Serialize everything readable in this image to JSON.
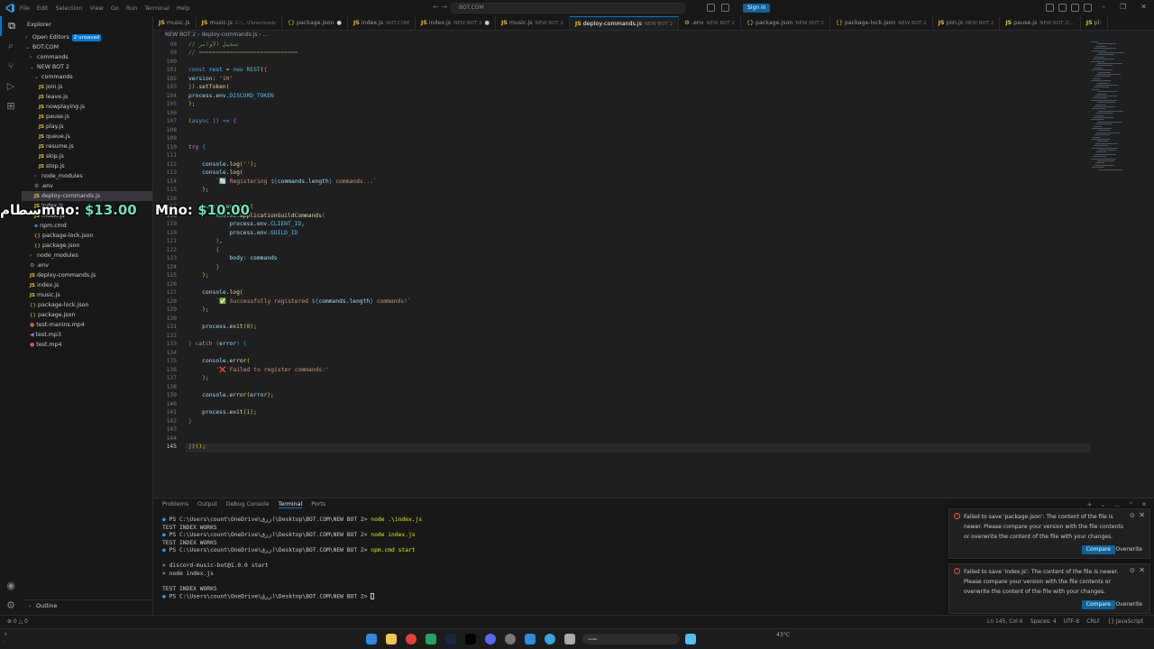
{
  "titlebar": {
    "menu": [
      "File",
      "Edit",
      "Selection",
      "View",
      "Go",
      "Run",
      "Terminal",
      "Help"
    ],
    "search": "BOT.COM",
    "signin": "Sign in"
  },
  "sidebar": {
    "title": "Explorer",
    "open_editors": "Open Editors",
    "open_editors_badge": "2 unsaved",
    "root": "BOT.COM",
    "outline": "Outline",
    "rows": [
      {
        "indent": 1,
        "chev": "›",
        "icon": "",
        "label": "commands"
      },
      {
        "indent": 1,
        "chev": "⌄",
        "icon": "",
        "label": "NEW BOT 2"
      },
      {
        "indent": 2,
        "chev": "⌄",
        "icon": "",
        "label": "commands"
      },
      {
        "indent": 3,
        "chev": "",
        "icon": "js",
        "label": "join.js"
      },
      {
        "indent": 3,
        "chev": "",
        "icon": "js",
        "label": "leave.js"
      },
      {
        "indent": 3,
        "chev": "",
        "icon": "js",
        "label": "nowplaying.js"
      },
      {
        "indent": 3,
        "chev": "",
        "icon": "js",
        "label": "pause.js"
      },
      {
        "indent": 3,
        "chev": "",
        "icon": "js",
        "label": "play.js"
      },
      {
        "indent": 3,
        "chev": "",
        "icon": "js",
        "label": "queue.js"
      },
      {
        "indent": 3,
        "chev": "",
        "icon": "js",
        "label": "resume.js"
      },
      {
        "indent": 3,
        "chev": "",
        "icon": "js",
        "label": "skip.js"
      },
      {
        "indent": 3,
        "chev": "",
        "icon": "js",
        "label": "stop.js"
      },
      {
        "indent": 2,
        "chev": "›",
        "icon": "",
        "label": "node_modules"
      },
      {
        "indent": 2,
        "chev": "",
        "icon": "gear",
        "label": ".env"
      },
      {
        "indent": 2,
        "chev": "",
        "icon": "js",
        "label": "deploy-commands.js",
        "selected": true
      },
      {
        "indent": 2,
        "chev": "",
        "icon": "js",
        "label": "index.js"
      },
      {
        "indent": 2,
        "chev": "",
        "icon": "js",
        "label": "music.js"
      },
      {
        "indent": 2,
        "chev": "",
        "icon": "cmd",
        "label": "npm.cmd"
      },
      {
        "indent": 2,
        "chev": "",
        "icon": "json",
        "label": "package-lock.json"
      },
      {
        "indent": 2,
        "chev": "",
        "icon": "json",
        "label": "package.json"
      },
      {
        "indent": 1,
        "chev": "›",
        "icon": "",
        "label": "node_modules"
      },
      {
        "indent": 1,
        "chev": "",
        "icon": "gear",
        "label": ".env"
      },
      {
        "indent": 1,
        "chev": "",
        "icon": "js",
        "label": "deploy-commands.js"
      },
      {
        "indent": 1,
        "chev": "",
        "icon": "js",
        "label": "index.js"
      },
      {
        "indent": 1,
        "chev": "",
        "icon": "js",
        "label": "music.js"
      },
      {
        "indent": 1,
        "chev": "",
        "icon": "json",
        "label": "package-lock.json"
      },
      {
        "indent": 1,
        "chev": "",
        "icon": "json",
        "label": "package.json"
      },
      {
        "indent": 1,
        "chev": "",
        "icon": "media",
        "label": "test-manins.mp4"
      },
      {
        "indent": 1,
        "chev": "",
        "icon": "audio",
        "label": "test.mp3"
      },
      {
        "indent": 1,
        "chev": "",
        "icon": "media",
        "label": "test.mp4"
      }
    ]
  },
  "overlay": {
    "text1_prefix": "سطام",
    "text1_label": "mno:",
    "text1_value": "$13.00",
    "text2_label": "Mno:",
    "text2_value": "$10.00"
  },
  "tabs": [
    {
      "icon": "js",
      "label": "music.js",
      "path": "",
      "dot": false,
      "active": false
    },
    {
      "icon": "js",
      "label": "music.js",
      "path": "C:\\...\\Downloads",
      "dot": false,
      "active": false
    },
    {
      "icon": "json",
      "label": "package.json",
      "path": "",
      "dot": true,
      "active": false
    },
    {
      "icon": "js",
      "label": "index.js",
      "path": "NOT.COM",
      "dot": false,
      "active": false
    },
    {
      "icon": "js",
      "label": "index.js",
      "path": "NEW BOT 2",
      "dot": true,
      "active": false
    },
    {
      "icon": "js",
      "label": "music.js",
      "path": "NEW BOT 2",
      "dot": false,
      "active": false
    },
    {
      "icon": "js",
      "label": "deploy-commands.js",
      "path": "NEW BOT 2",
      "dot": false,
      "active": true
    },
    {
      "icon": "gear",
      "label": ".env",
      "path": "NEW BOT 2",
      "dot": false,
      "active": false
    },
    {
      "icon": "json",
      "label": "package.json",
      "path": "NEW BOT 2",
      "dot": false,
      "active": false
    },
    {
      "icon": "json",
      "label": "package-lock.json",
      "path": "NEW BOT 2",
      "dot": false,
      "active": false
    },
    {
      "icon": "js",
      "label": "join.js",
      "path": "NEW BOT 2",
      "dot": false,
      "active": false
    },
    {
      "icon": "js",
      "label": "pause.js",
      "path": "NEW BOT 2\\...",
      "dot": false,
      "active": false
    },
    {
      "icon": "js",
      "label": "pl:",
      "path": "",
      "dot": false,
      "active": false
    }
  ],
  "breadcrumb": [
    "NEW BOT 2",
    "deploy-commands.js",
    "..."
  ],
  "code_lines": [
    {
      "n": 98,
      "html": "<span class=\"cmt\">// تسجيل الأوامر</span>"
    },
    {
      "n": 99,
      "html": "<span class=\"cmt\">// =============================</span>"
    },
    {
      "n": 100,
      "html": ""
    },
    {
      "n": 101,
      "html": "<span class=\"kw\">const</span> <span class=\"cst\">rest</span> = <span class=\"kw\">new</span> <span class=\"cls\">REST</span><span class=\"br1\">(</span><span class=\"br2\">{</span>"
    },
    {
      "n": 102,
      "html": "<span class=\"var\">version</span>: <span class=\"str\">'10'</span>"
    },
    {
      "n": 103,
      "html": "<span class=\"br2\">}</span><span class=\"br1\">)</span>.<span class=\"fn\">setToken</span><span class=\"br1\">(</span>"
    },
    {
      "n": 104,
      "html": "<span class=\"var\">process</span>.<span class=\"var\">env</span>.<span class=\"cst\">DISCORD_TOKEN</span>"
    },
    {
      "n": 105,
      "html": "<span class=\"br1\">)</span>;"
    },
    {
      "n": 106,
      "html": ""
    },
    {
      "n": 107,
      "html": "<span class=\"br1\">(</span><span class=\"kw\">async</span> <span class=\"br2\">()</span> <span class=\"kw\">=></span> <span class=\"br2\">{</span>"
    },
    {
      "n": 108,
      "html": ""
    },
    {
      "n": 109,
      "html": ""
    },
    {
      "n": 110,
      "html": "<span class=\"kw2\">try</span> <span class=\"br3\">{</span>"
    },
    {
      "n": 111,
      "html": ""
    },
    {
      "n": 112,
      "html": "    <span class=\"var\">console</span>.<span class=\"fn\">log</span><span class=\"br1\">(</span><span class=\"str\">''</span><span class=\"br1\">)</span>;"
    },
    {
      "n": 113,
      "html": "    <span class=\"var\">console</span>.<span class=\"fn\">log</span><span class=\"br1\">(</span>"
    },
    {
      "n": 114,
      "html": "        <span class=\"str\">`🔄 Registering </span><span class=\"kw\">${</span><span class=\"var\">commands</span>.<span class=\"var\">length</span><span class=\"kw\">}</span><span class=\"str\"> commands...`</span>"
    },
    {
      "n": 115,
      "html": "    <span class=\"br1\">)</span>;"
    },
    {
      "n": 116,
      "html": ""
    },
    {
      "n": 117,
      "html": "    <span class=\"kw2\">await</span> <span class=\"var\">rest</span>.<span class=\"fn\">put</span><span class=\"br1\">(</span>"
    },
    {
      "n": 118,
      "html": "        <span class=\"cls\">Routes</span>.<span class=\"fn\">applicationGuildCommands</span><span class=\"br2\">(</span>"
    },
    {
      "n": 119,
      "html": "            <span class=\"var\">process</span>.<span class=\"var\">env</span>.<span class=\"cst\">CLIENT_ID</span>,"
    },
    {
      "n": 120,
      "html": "            <span class=\"var\">process</span>.<span class=\"var\">env</span>.<span class=\"cst\">GUILD_ID</span>"
    },
    {
      "n": 121,
      "html": "        <span class=\"br2\">)</span>,"
    },
    {
      "n": 122,
      "html": "        <span class=\"br2\">{</span>"
    },
    {
      "n": 123,
      "html": "            <span class=\"var\">body</span>: <span class=\"var\">commands</span>"
    },
    {
      "n": 124,
      "html": "        <span class=\"br2\">}</span>"
    },
    {
      "n": 125,
      "html": "    <span class=\"br1\">)</span>;"
    },
    {
      "n": 126,
      "html": ""
    },
    {
      "n": 127,
      "html": "    <span class=\"var\">console</span>.<span class=\"fn\">log</span><span class=\"br1\">(</span>"
    },
    {
      "n": 128,
      "html": "        <span class=\"str\">`✅ Successfully registered </span><span class=\"kw\">${</span><span class=\"var\">commands</span>.<span class=\"var\">length</span><span class=\"kw\">}</span><span class=\"str\"> commands!`</span>"
    },
    {
      "n": 129,
      "html": "    <span class=\"br1\">)</span>;"
    },
    {
      "n": 130,
      "html": ""
    },
    {
      "n": 131,
      "html": "    <span class=\"var\">process</span>.<span class=\"fn\">exit</span><span class=\"br1\">(</span><span class=\"num\">0</span><span class=\"br1\">)</span>;"
    },
    {
      "n": 132,
      "html": ""
    },
    {
      "n": 133,
      "html": "<span class=\"br3\">}</span> <span class=\"kw2\">catch</span> <span class=\"br3\">(</span><span class=\"var\">error</span><span class=\"br3\">)</span> <span class=\"br3\">{</span>"
    },
    {
      "n": 134,
      "html": ""
    },
    {
      "n": 135,
      "html": "    <span class=\"var\">console</span>.<span class=\"fn\">error</span><span class=\"br1\">(</span>"
    },
    {
      "n": 136,
      "html": "        <span class=\"str\">'❌ Failed to register commands:'</span>"
    },
    {
      "n": 137,
      "html": "    <span class=\"br1\">)</span>;"
    },
    {
      "n": 138,
      "html": ""
    },
    {
      "n": 139,
      "html": "    <span class=\"var\">console</span>.<span class=\"fn\">error</span><span class=\"br1\">(</span><span class=\"var\">error</span><span class=\"br1\">)</span>;"
    },
    {
      "n": 140,
      "html": ""
    },
    {
      "n": 141,
      "html": "    <span class=\"var\">process</span>.<span class=\"fn\">exit</span><span class=\"br1\">(</span><span class=\"num\">1</span><span class=\"br1\">)</span>;"
    },
    {
      "n": 142,
      "html": "<span class=\"br3\">}</span>"
    },
    {
      "n": 143,
      "html": ""
    },
    {
      "n": 144,
      "html": ""
    },
    {
      "n": 145,
      "html": "<span class=\"br2\">}</span><span class=\"br1\">)</span><span class=\"br1\">()</span>;"
    }
  ],
  "panel": {
    "tabs": [
      "Problems",
      "Output",
      "Debug Console",
      "Terminal",
      "Ports"
    ],
    "active_tab": "Terminal"
  },
  "terminal": [
    {
      "type": "ps",
      "prompt": "PS C:\\Users\\count\\OneDrive\\ازرق\\Desktop\\BOT.COM\\NEW BOT 2> ",
      "cmd": "node .\\index.js"
    },
    {
      "type": "out",
      "text": "TEST INDEX WORKS"
    },
    {
      "type": "ps",
      "prompt": "PS C:\\Users\\count\\OneDrive\\ازرق\\Desktop\\BOT.COM\\NEW BOT 2> ",
      "cmd": "node index.js"
    },
    {
      "type": "out",
      "text": "TEST INDEX WORKS"
    },
    {
      "type": "ps",
      "prompt": "PS C:\\Users\\count\\OneDrive\\ازرق\\Desktop\\BOT.COM\\NEW BOT 2> ",
      "cmd": "npm.cmd start"
    },
    {
      "type": "out",
      "text": ""
    },
    {
      "type": "out",
      "text": "> discord-music-bot@1.0.0 start"
    },
    {
      "type": "out",
      "text": "> node index.js"
    },
    {
      "type": "out",
      "text": ""
    },
    {
      "type": "out",
      "text": "TEST INDEX WORKS"
    },
    {
      "type": "ps_cursor",
      "prompt": "PS C:\\Users\\count\\OneDrive\\ازرق\\Desktop\\BOT.COM\\NEW BOT 2> ",
      "cmd": ""
    }
  ],
  "notifications": [
    {
      "message": "Failed to save 'package.json': The content of the file is newer. Please compare your version with the file contents or overwrite the content of the file with your changes.",
      "compare": "Compare",
      "overwrite": "Overwrite"
    },
    {
      "message": "Failed to save 'index.js': The content of the file is newer. Please compare your version with the file contents or overwrite the content of the file with your changes.",
      "compare": "Compare",
      "overwrite": "Overwrite"
    }
  ],
  "statusbar": {
    "left": "⊗ 0 △ 0",
    "right": [
      "Ln 145, Col 6",
      "Spaces: 4",
      "UTF-8",
      "CRLF",
      "{} JavaScript"
    ]
  },
  "taskbar": {
    "search": "بحث",
    "weather": "43°C"
  },
  "colors": {
    "accent": "#0078d4",
    "error": "#f14c4c",
    "overlay_money": "#6fe0b8"
  }
}
